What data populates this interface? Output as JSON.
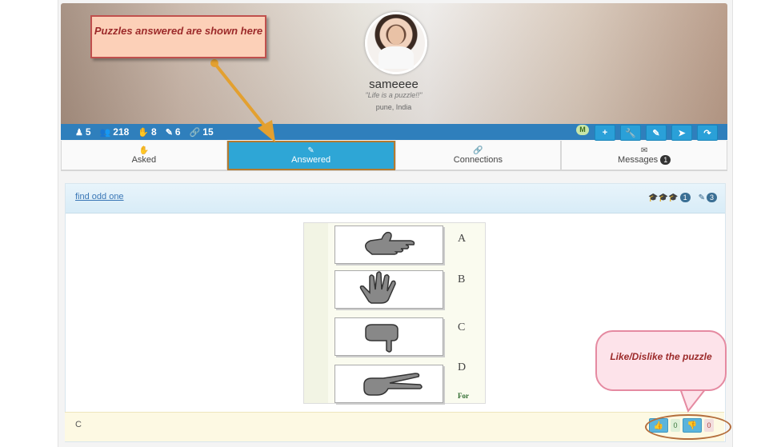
{
  "profile": {
    "username": "sameeee",
    "motto": "\"Life is a puzzle!!\"",
    "location": "pune, India"
  },
  "stats": [
    {
      "icon": "person-stack-icon",
      "value": "5"
    },
    {
      "icon": "people-icon",
      "value": "218"
    },
    {
      "icon": "hand-icon",
      "value": "8"
    },
    {
      "icon": "answer-icon",
      "value": "6"
    },
    {
      "icon": "link-icon",
      "value": "15"
    }
  ],
  "actions": {
    "badge": "M",
    "add": "+",
    "settings": "wrench",
    "edit": "edit",
    "send": "send",
    "share": "share"
  },
  "tabs": {
    "asked": "Asked",
    "answered": "Answered",
    "connections": "Connections",
    "messages": "Messages",
    "messages_count": "1"
  },
  "puzzle": {
    "title": "find odd one",
    "level_count": "1",
    "answers_count": "3",
    "options": [
      "A",
      "B",
      "C",
      "D"
    ],
    "footer_text": "For",
    "answer": "C"
  },
  "votes": {
    "likes": "0",
    "dislikes": "0"
  },
  "annotations": {
    "answered_callout": "Puzzles answered are shown here",
    "vote_callout": "Like/Dislike the puzzle"
  },
  "colors": {
    "accent": "#2f7fbc",
    "active_tab": "#2ea6d6",
    "callout_border": "#c0504d",
    "arrow": "#e3a030"
  }
}
